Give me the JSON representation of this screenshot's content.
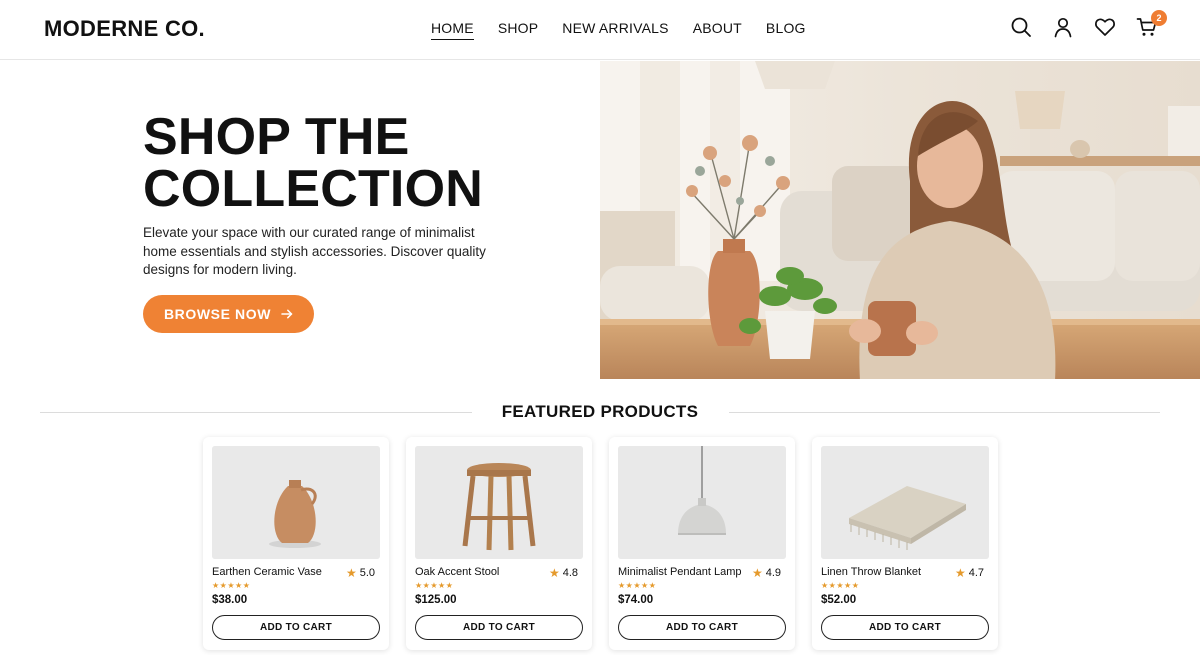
{
  "header": {
    "logo": "MODERNE CO.",
    "nav": [
      "HOME",
      "SHOP",
      "NEW ARRIVALS",
      "ABOUT",
      "BLOG"
    ],
    "active_nav": "HOME",
    "icons": [
      "search-icon",
      "user-icon",
      "heart-icon",
      "cart-icon"
    ],
    "cart_count": "2"
  },
  "hero": {
    "title_line1": "SHOP THE",
    "title_line2": "COLLECTION",
    "description": "Elevate your space with our curated range of minimalist home essentials and stylish accessories. Discover quality designs for modern living.",
    "button_label": "BROWSE NOW",
    "button_icon": "arrow-right-icon"
  },
  "featured": {
    "title": "FEATURED PRODUCTS",
    "products": [
      {
        "name": "Earthen Ceramic Vase",
        "rating": "5.0",
        "stars": "★★★★★",
        "price": "$38.00",
        "cta": "ADD TO CART"
      },
      {
        "name": "Oak Accent Stool",
        "rating": "4.8",
        "stars": "★★★★★",
        "price": "$125.00",
        "cta": "ADD TO CART"
      },
      {
        "name": "Minimalist Pendant Lamp",
        "rating": "4.9",
        "stars": "★★★★★",
        "price": "$74.00",
        "cta": "ADD TO CART"
      },
      {
        "name": "Linen Throw Blanket",
        "rating": "4.7",
        "stars": "★★★★★",
        "price": "$52.00",
        "cta": "ADD TO CART"
      }
    ]
  },
  "colors": {
    "accent": "#ef8234",
    "star": "#e59a2c",
    "text": "#111111"
  }
}
